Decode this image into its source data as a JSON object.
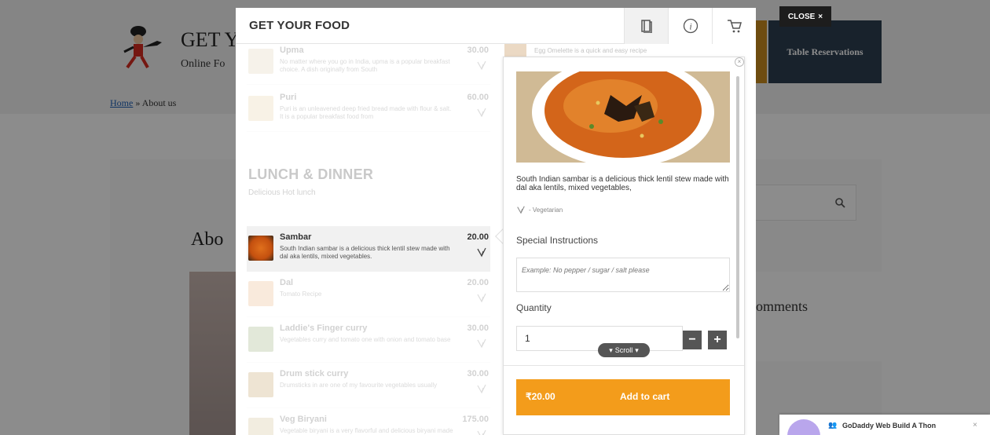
{
  "background_site": {
    "site_title": "GET Y",
    "tagline": "Online Fo",
    "breadcrumb": {
      "home": "Home",
      "separator": " » ",
      "current": "About us"
    },
    "table_reservations": "Table Reservations",
    "page_heading": "Abo",
    "comments_heading": "omments"
  },
  "close_overlay": {
    "label": "CLOSE",
    "icon": "close-icon"
  },
  "widget": {
    "title": "GET YOUR FOOD",
    "tabs": [
      {
        "name": "menu",
        "icon": "menu-book-icon",
        "active": true
      },
      {
        "name": "info",
        "icon": "info-icon",
        "active": false
      },
      {
        "name": "cart",
        "icon": "cart-icon",
        "active": false
      }
    ],
    "menu": {
      "items_before": [
        {
          "name": "Upma",
          "price": "30.00",
          "desc": "No matter where you go in India, upma is a popular breakfast choice. A dish originally from South"
        },
        {
          "name": "Puri",
          "price": "60.00",
          "desc": "Puri is an unleavened deep fried bread made with flour & salt. It is a popular breakfast food from"
        }
      ],
      "category": {
        "title": "LUNCH & DINNER",
        "subtitle": "Delicious Hot lunch"
      },
      "items": [
        {
          "name": "Sambar",
          "price": "20.00",
          "desc": "South Indian sambar is a delicious thick lentil stew made with dal aka lentils, mixed vegetables.",
          "selected": true
        },
        {
          "name": "Dal",
          "price": "20.00",
          "desc": "Tomato Recipe",
          "selected": false
        },
        {
          "name": "Laddie's Finger curry",
          "price": "30.00",
          "desc": "Vegetables curry and tomato one with onion and tomato base",
          "selected": false
        },
        {
          "name": "Drum stick curry",
          "price": "30.00",
          "desc": "Drumsticks in are one of my favourite vegetables usually",
          "selected": false
        },
        {
          "name": "Veg Biryani",
          "price": "175.00",
          "desc": "Vegetable biryani is a very flavorful and delicious biryani made with rice and vegetables",
          "selected": false
        }
      ]
    },
    "detail": {
      "top_strip_text": "Egg Omelette is a quick and easy recipe",
      "description": "South Indian sambar is a delicious thick lentil stew made with dal aka lentils, mixed vegetables,",
      "veg_label": "- Vegetarian",
      "special_instructions_label": "Special Instructions",
      "special_instructions_placeholder": "Example: No pepper / sugar / salt please",
      "quantity_label": "Quantity",
      "quantity_value": "1",
      "minus_label": "−",
      "plus_label": "+",
      "scroll_label": "Scroll",
      "add_price": "₹20.00",
      "add_label": "Add to cart"
    }
  },
  "toast": {
    "text": "GoDaddy Web Build A Thon",
    "close": "×"
  },
  "colors": {
    "accent": "#f39c1b",
    "dark_button": "#555555",
    "reservation_bg": "#2c3e50"
  }
}
